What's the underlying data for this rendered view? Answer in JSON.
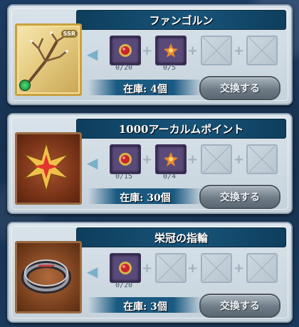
{
  "exchange_items": [
    {
      "title": "ファンゴルン",
      "badge": "SSR",
      "stock": "在庫: 4個",
      "exchange_label": "交換する",
      "materials": [
        {
          "icon": "red-gem-icon",
          "count": "0/20"
        },
        {
          "icon": "orange-crest-icon",
          "count": "0/5"
        }
      ],
      "empty_slots": 2
    },
    {
      "title": "1000アーカルムポイント",
      "stock": "在庫: 30個",
      "exchange_label": "交換する",
      "materials": [
        {
          "icon": "red-gem-icon",
          "count": "0/15"
        },
        {
          "icon": "orange-crest-icon",
          "count": "0/4"
        }
      ],
      "empty_slots": 2
    },
    {
      "title": "栄冠の指輪",
      "stock": "在庫: 3個",
      "exchange_label": "交換する",
      "materials": [
        {
          "icon": "red-gem-icon",
          "count": "0/20"
        }
      ],
      "empty_slots": 3
    }
  ]
}
